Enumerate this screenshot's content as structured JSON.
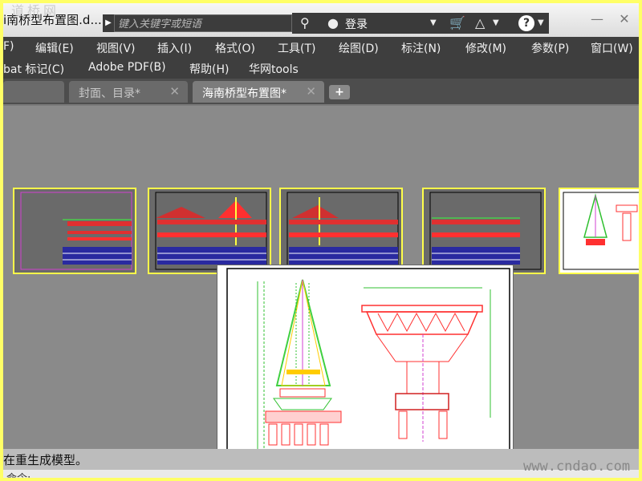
{
  "window": {
    "doc_title": "i南桥型布置图.d...",
    "watermark_top": "道桥网"
  },
  "search": {
    "placeholder": "键入关键字或短语"
  },
  "login": {
    "label": "登录"
  },
  "menu_row1": [
    "F)",
    "编辑(E)",
    "视图(V)",
    "插入(I)",
    "格式(O)",
    "工具(T)",
    "绘图(D)",
    "标注(N)",
    "修改(M)",
    "参数(P)",
    "窗口(W)"
  ],
  "menu_row2": [
    "bat 标记(C)",
    "Adobe PDF(B)",
    "帮助(H)",
    "华网tools"
  ],
  "tabs": [
    {
      "label": "封面、目录*",
      "active": false
    },
    {
      "label": "海南桥型布置图*",
      "active": true
    }
  ],
  "status": {
    "message": "在重生成模型。",
    "command": "命令:"
  },
  "site_watermark": "www.cndao.com",
  "colors": {
    "background_highlight": "#ffff66",
    "panel": "#8a8a8a",
    "menubar": "#3e3e3e",
    "thumb_border": "#ffff4a"
  }
}
